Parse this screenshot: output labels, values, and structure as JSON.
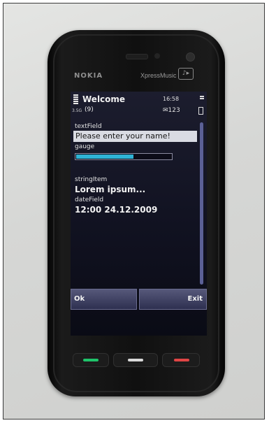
{
  "device": {
    "brand": "NOKIA",
    "edition": "XpressMusic",
    "music_key_glyph": "♪▸"
  },
  "status_bar": {
    "title": "Welcome",
    "time": "16:58",
    "network": "3.5G",
    "count": "(9)",
    "messages": "✉123",
    "menu_icon": "menu-lines-icon",
    "battery_icon": "battery-icon"
  },
  "form": {
    "text_field": {
      "label": "textField",
      "value": "Please enter your name!"
    },
    "gauge": {
      "label": "gauge",
      "level": 0.6
    },
    "string_item": {
      "label": "stringItem",
      "value": "Lorem ipsum..."
    },
    "date_field": {
      "label": "dateField",
      "value": "12:00 24.12.2009"
    }
  },
  "softkeys": {
    "left": "Ok",
    "right": "Exit"
  },
  "colors": {
    "screen_bg": "#111221",
    "gauge_fill": "#2fb3d6",
    "softkey": "#3e4063",
    "call_led": "#1fc36a",
    "end_led": "#e04545"
  }
}
